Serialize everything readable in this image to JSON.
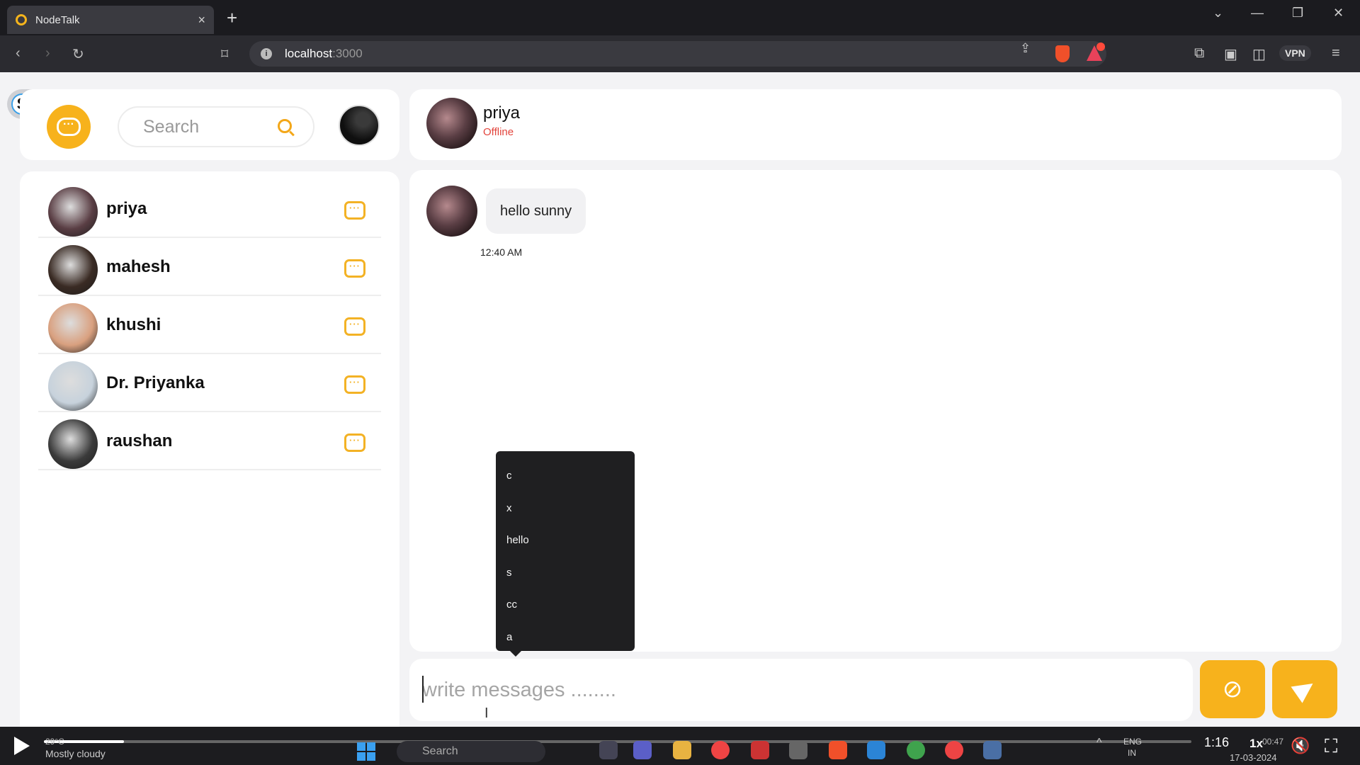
{
  "browser": {
    "tab_title": "NodeTalk",
    "tab_close": "×",
    "new_tab": "+",
    "url_host": "localhost",
    "url_port": ":3000",
    "vpn_label": "VPN",
    "window_controls": [
      "⌄",
      "—",
      "❐",
      "✕"
    ]
  },
  "app": {
    "badge_letter": "S",
    "logo_glyph": "···",
    "search": {
      "placeholder": "Search"
    },
    "contacts": [
      {
        "name": "priya",
        "avatar_color": "#5a3e44"
      },
      {
        "name": "mahesh",
        "avatar_color": "#3a2b24"
      },
      {
        "name": "khushi",
        "avatar_color": "#d9a07f"
      },
      {
        "name": "Dr. Priyanka",
        "avatar_color": "#c7d2dc"
      },
      {
        "name": "raushan",
        "avatar_color": "#3b3b3b"
      }
    ],
    "chat_icon_glyph": "···",
    "chat": {
      "name": "priya",
      "status": "Offline",
      "messages": [
        {
          "text": "hello sunny",
          "time": "12:40 AM"
        }
      ]
    },
    "autocomplete": [
      "c",
      "x",
      "hello",
      "s",
      "cc",
      "a"
    ],
    "composer": {
      "placeholder": "write messages ........"
    },
    "attach_glyph": "⊘"
  },
  "player": {
    "weather_temp": "29°C",
    "weather_text": "Mostly cloudy",
    "taskbar_search": "Search",
    "progress": 0.07,
    "video_time": "1:16",
    "speed": "1x",
    "lang_top": "ENG",
    "lang_bottom": "IN",
    "clock_time": "00:47",
    "clock_date": "17-03-2024"
  },
  "colors": {
    "accent": "#f7b21c",
    "offline": "#e2443c",
    "tooltip_bg": "#1f1f21"
  }
}
